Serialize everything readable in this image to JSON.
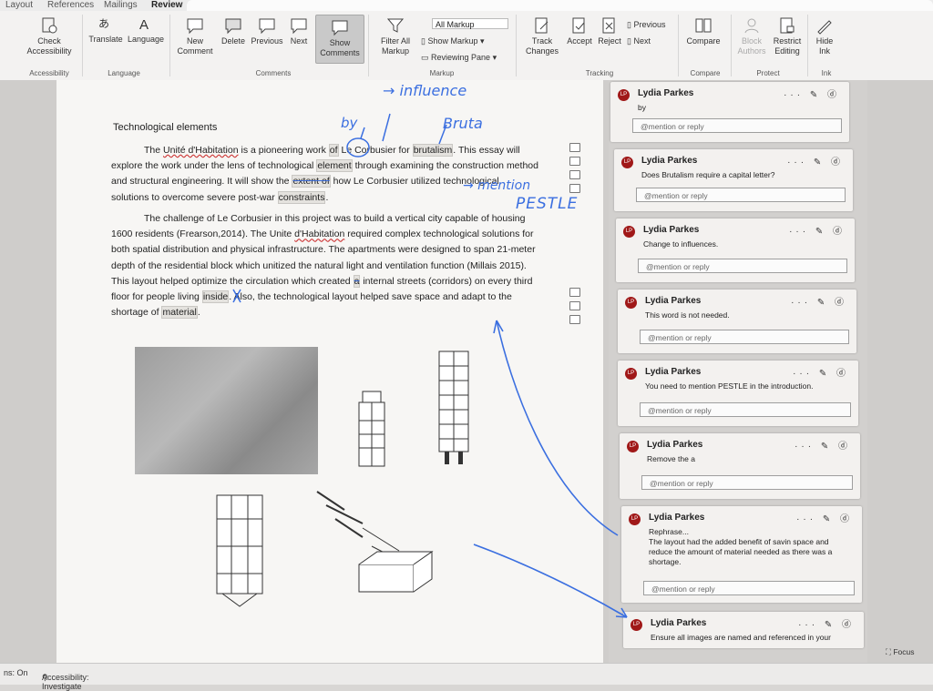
{
  "tabs": [
    "Layout",
    "References",
    "Mailings",
    "Review"
  ],
  "active_tab": "Review",
  "ribbon": {
    "accessibility": {
      "button": "Check Accessibility",
      "group": "Accessibility"
    },
    "language": {
      "translate": "Translate",
      "language": "Language",
      "group": "Language"
    },
    "comments": {
      "new": "New Comment",
      "delete": "Delete",
      "previous": "Previous",
      "next": "Next",
      "show": "Show Comments",
      "group": "Comments"
    },
    "markup": {
      "filter": "Filter All Markup",
      "display_select": "All Markup",
      "show_markup": "Show Markup",
      "reviewing_pane": "Reviewing Pane",
      "group": "Markup"
    },
    "tracking": {
      "track": "Track Changes",
      "accept": "Accept",
      "reject": "Reject",
      "previous": "Previous",
      "next": "Next",
      "group": "Tracking"
    },
    "compare": {
      "compare": "Compare",
      "group": "Compare"
    },
    "protect": {
      "block": "Block Authors",
      "restrict": "Restrict Editing",
      "group": "Protect"
    },
    "ink": {
      "hide": "Hide Ink",
      "group": "Ink"
    }
  },
  "document": {
    "heading": "Technological elements",
    "p1": {
      "a": "The ",
      "b": "Unité d'Habitation",
      "c": " is a pioneering work ",
      "d": "of",
      "e": " Le Corbusier for ",
      "f": "brutalism",
      "g": ". This essay will explore the work under the lens of technological ",
      "h": "element",
      "i": " through examining the construction method and structural engineering. It will show the ",
      "j": "extent of",
      "k": " how Le Corbusier utilized technological solutions to overcome severe post-war ",
      "l": "constraints",
      "m": "."
    },
    "p2": {
      "a": "The challenge of Le Corbusier in this project was to build a vertical city capable of housing 1600 residents (Frearson,2014). The Unite ",
      "b": "d'Habitation",
      "c": " required complex technological solutions for both spatial distribution and physical infrastructure. The apartments were designed to span 21-meter depth of the residential block which unitized the natural light and ventilation function (Millais 2015). This layout helped optimize the circulation which created ",
      "d": "a",
      "e": " internal streets (corridors) on every third floor for people living ",
      "f": "inside",
      "g": ". Also, the technological layout helped save space and adapt to the shortage of ",
      "h": "material",
      "i": "."
    }
  },
  "ink_notes": {
    "influence": "→ influence",
    "by": "by",
    "bruta": "Bruta",
    "mention": "→ mention",
    "pestle": "PESTLE"
  },
  "comments": [
    {
      "avatar": "LP",
      "author": "Lydia Parkes",
      "body": "by",
      "reply_placeholder": "@mention or reply"
    },
    {
      "avatar": "LP",
      "author": "Lydia Parkes",
      "body": "Does Brutalism require a capital letter?",
      "reply_placeholder": "@mention or reply"
    },
    {
      "avatar": "LP",
      "author": "Lydia Parkes",
      "body": "Change to influences.",
      "reply_placeholder": "@mention or reply"
    },
    {
      "avatar": "LP",
      "author": "Lydia Parkes",
      "body": "This word is not needed.",
      "reply_placeholder": "@mention or reply"
    },
    {
      "avatar": "LP",
      "author": "Lydia Parkes",
      "body": "You need to mention PESTLE in the introduction.",
      "reply_placeholder": "@mention or reply"
    },
    {
      "avatar": "LP",
      "author": "Lydia Parkes",
      "body": "Remove the a",
      "reply_placeholder": "@mention or reply"
    },
    {
      "avatar": "LP",
      "author": "Lydia Parkes",
      "body": "Rephrase...\nThe layout had the added benefit of savin space and reduce the amount of material needed as there was a shortage.",
      "reply_placeholder": "@mention or reply"
    },
    {
      "avatar": "LP",
      "author": "Lydia Parkes",
      "body": "Ensure all images are named and referenced in your",
      "reply_placeholder": ""
    }
  ],
  "comment_actions": "··· ✎ ⓓ",
  "status": {
    "left": "ns: On",
    "accessibility": "Accessibility: Investigate",
    "focus": "Focus"
  },
  "colors": {
    "ink": "#3b6fe0",
    "avatar": "#a01818",
    "ribbon_bg": "#f3f2f1"
  }
}
